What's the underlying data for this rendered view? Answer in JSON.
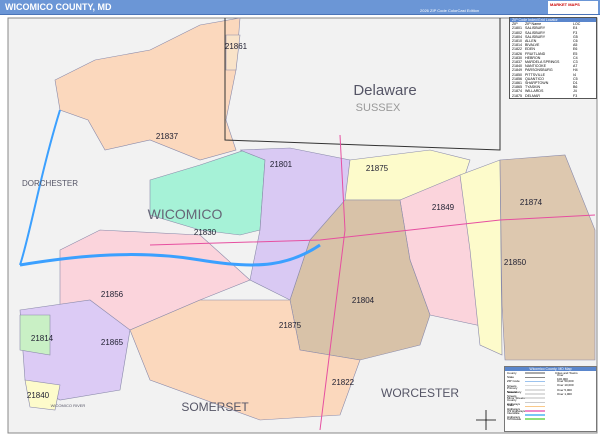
{
  "header": {
    "title": "WICOMICO COUNTY, MD",
    "edition": "2026 ZIP Code ColorCast Edition",
    "logo": "MARKET MAPS"
  },
  "regions": {
    "delaware": "Delaware",
    "sussex": "SUSSEX",
    "dorchester": "DORCHESTER",
    "wicomico": "WICOMICO",
    "somerset": "SOMERSET",
    "worcester": "WORCESTER",
    "wicomico_river": "WICOMICO RIVER"
  },
  "zip_labels": [
    "21861",
    "21837",
    "21801",
    "21875",
    "21849",
    "21874",
    "21830",
    "21850",
    "21856",
    "21804",
    "21814",
    "21865",
    "21875",
    "21822",
    "21840"
  ],
  "locator": {
    "title": "ZIP Code Index/Grid Locator",
    "headers": [
      "ZIP",
      "ZIP Name",
      "LOC"
    ],
    "rows": [
      [
        "21801",
        "SALISBURY",
        "E4"
      ],
      [
        "21802",
        "SALISBURY",
        "F3"
      ],
      [
        "21804",
        "SALISBURY",
        "G5"
      ],
      [
        "21810",
        "ALLEN",
        "C6"
      ],
      [
        "21814",
        "BIVALVE",
        "A5"
      ],
      [
        "21822",
        "EDEN",
        "E6"
      ],
      [
        "21826",
        "FRUITLAND",
        "E5"
      ],
      [
        "21830",
        "HEBRON",
        "C4"
      ],
      [
        "21837",
        "MARDELA SPRINGS",
        "C3"
      ],
      [
        "21840",
        "NANTICOKE",
        "A7"
      ],
      [
        "21849",
        "PARSONSBURG",
        "H4"
      ],
      [
        "21850",
        "PITTSVILLE",
        "I4"
      ],
      [
        "21856",
        "QUANTICO",
        "C5"
      ],
      [
        "21861",
        "SHARPTOWN",
        "D1"
      ],
      [
        "21865",
        "TYASKIN",
        "B6"
      ],
      [
        "21874",
        "WILLARDS",
        "J4"
      ],
      [
        "21875",
        "DELMAR",
        "F3"
      ]
    ]
  },
  "legend": {
    "title": "Wicomico County, MD Map",
    "items": [
      "County",
      "State",
      "ZIP Code",
      "Streets",
      "Primary Streets",
      "Secondary Streets",
      "Minor Streets",
      "County Highways",
      "State Highways",
      "US Highways",
      "Interstate Highways",
      "Toll Roads"
    ],
    "city_title": "Cities and Towns",
    "cities": [
      "Over 100,000",
      "Over 50,000",
      "Over 10,000",
      "Over 5,000",
      "Over 1,000"
    ]
  }
}
